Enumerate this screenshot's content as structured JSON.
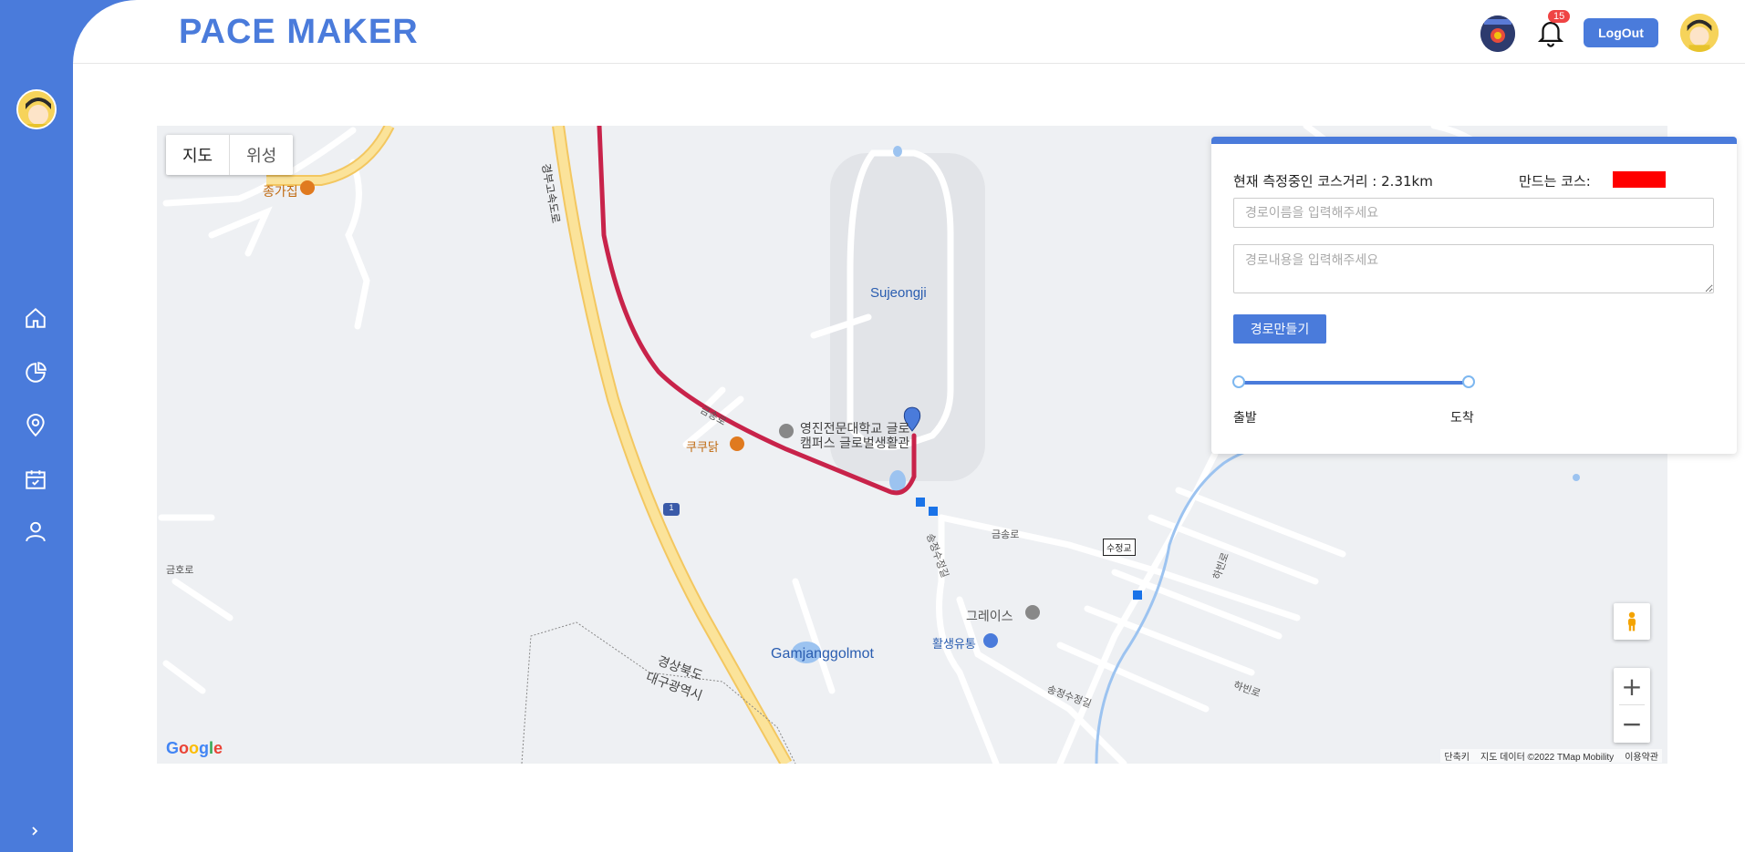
{
  "app": {
    "title": "PACE MAKER"
  },
  "header": {
    "notification_count": "15",
    "logout_label": "LogOut"
  },
  "sidebar": {
    "items": [
      {
        "name": "home",
        "icon": "home-icon"
      },
      {
        "name": "stats",
        "icon": "pie-chart-icon"
      },
      {
        "name": "map",
        "icon": "location-pin-icon"
      },
      {
        "name": "calendar",
        "icon": "calendar-check-icon"
      },
      {
        "name": "profile",
        "icon": "user-icon"
      }
    ],
    "expand_icon": "chevron-right-icon"
  },
  "map": {
    "tabs": [
      "지도",
      "위성"
    ],
    "active_tab": "지도",
    "labels": {
      "restaurant1": "종가집",
      "restaurant2": "쿠쿠닭",
      "expressway": "경부고속도로",
      "place1": "Sujeongji",
      "college": "영진전문대학교 글로",
      "college2": "캠퍼스 글로벌생활관",
      "road1": "금송로",
      "road2": "금호로",
      "road3": "송정수정길",
      "church": "그레이스",
      "shop": "활생유통",
      "bridge": "수정교",
      "pond": "Gamjanggolmot",
      "region": "경상북도",
      "region2": "대구광역시",
      "road4": "하빈로",
      "road5": "송정수정길",
      "route_no": "1"
    },
    "google_logo": "Google",
    "attribution": [
      "단축키",
      "지도 데이터 ©2022 TMap Mobility",
      "이용약관"
    ],
    "route_color": "#c8234a"
  },
  "panel": {
    "distance_text": "현재 측정중인 코스거리 : 2.31km",
    "course_label": "만드는 코스:",
    "course_color": "#ff0000",
    "name_placeholder": "경로이름을 입력해주세요",
    "desc_placeholder": "경로내용을 입력해주세요",
    "make_button": "경로만들기",
    "slider_start": "출발",
    "slider_end": "도착",
    "slider_range": [
      0,
      1
    ]
  }
}
